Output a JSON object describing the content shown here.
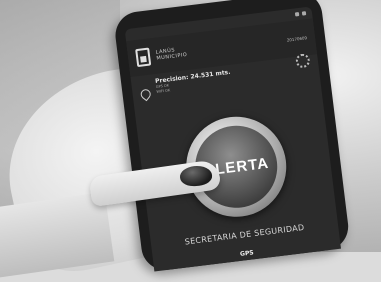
{
  "app": {
    "logo_line1": "LANÚS",
    "logo_line2": "MUNICIPIO",
    "header_right": "20170609"
  },
  "info": {
    "precision": "Precision: 24.531 mts.",
    "gps_status": "GPS OK",
    "wifi_status": "WIFI OK"
  },
  "alert": {
    "button_label": "ALERTA"
  },
  "footer": {
    "department": "SECRETARIA DE SEGURIDAD",
    "bottom_label": "GPS"
  },
  "icons": {
    "logo": "municipio-logo-icon",
    "location": "map-pin-icon",
    "settings": "gear-icon"
  },
  "colors": {
    "screen_bg": "#2b2b2b",
    "alert_ring": "#a9a9a9",
    "alert_center": "#3e3e3e",
    "text_light": "#e6e6e6"
  }
}
